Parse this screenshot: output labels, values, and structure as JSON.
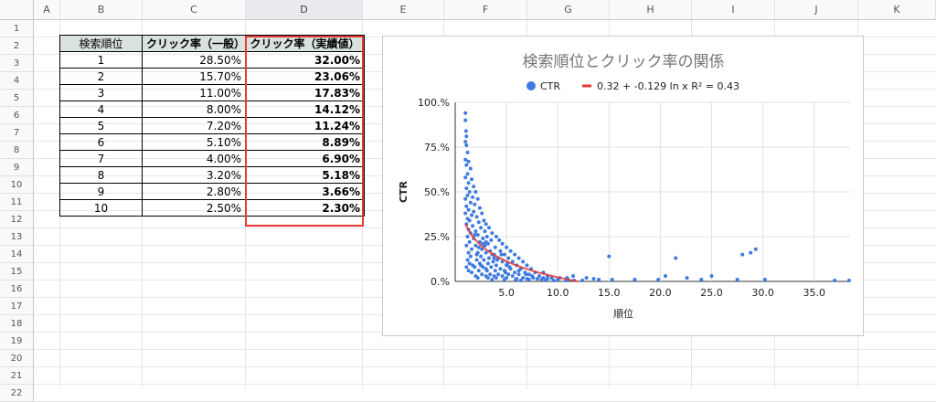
{
  "sheet": {
    "columns": [
      "A",
      "B",
      "C",
      "D",
      "E",
      "F",
      "G",
      "H",
      "I",
      "J",
      "K"
    ],
    "rows": [
      "1",
      "2",
      "3",
      "4",
      "5",
      "6",
      "7",
      "8",
      "9",
      "10",
      "11",
      "12",
      "13",
      "14",
      "15",
      "16",
      "17",
      "18",
      "19",
      "20",
      "21",
      "22"
    ]
  },
  "table": {
    "headers": [
      "検索順位",
      "クリック率（一般）",
      "クリック率（実績値）"
    ],
    "rows": [
      [
        "1",
        "28.50%",
        "32.00%"
      ],
      [
        "2",
        "15.70%",
        "23.06%"
      ],
      [
        "3",
        "11.00%",
        "17.83%"
      ],
      [
        "4",
        "8.00%",
        "14.12%"
      ],
      [
        "5",
        "7.20%",
        "11.24%"
      ],
      [
        "6",
        "5.10%",
        "8.89%"
      ],
      [
        "7",
        "4.00%",
        "6.90%"
      ],
      [
        "8",
        "3.20%",
        "5.18%"
      ],
      [
        "9",
        "2.80%",
        "3.66%"
      ],
      [
        "10",
        "2.50%",
        "2.30%"
      ]
    ]
  },
  "chart_data": {
    "type": "scatter",
    "title": "検索順位とクリック率の関係",
    "xlabel": "順位",
    "ylabel": "CTR",
    "xlim": [
      0,
      38.5
    ],
    "ylim": [
      0,
      1.0
    ],
    "xticks": [
      "5.0",
      "10.0",
      "15.0",
      "20.0",
      "25.0",
      "30.0",
      "35.0"
    ],
    "xtick_values": [
      5,
      10,
      15,
      20,
      25,
      30,
      35
    ],
    "yticks": [
      "0.%",
      "25.%",
      "50.%",
      "75.%",
      "100.%"
    ],
    "ytick_values": [
      0,
      0.25,
      0.5,
      0.75,
      1.0
    ],
    "grid": true,
    "legend_position": "top",
    "series": [
      {
        "name": "CTR",
        "color": "#3f7be0",
        "points": [
          [
            1.0,
            0.94
          ],
          [
            1.0,
            0.9
          ],
          [
            1.05,
            0.84
          ],
          [
            1.1,
            0.81
          ],
          [
            1.0,
            0.78
          ],
          [
            1.1,
            0.76
          ],
          [
            1.2,
            0.72
          ],
          [
            1.0,
            0.68
          ],
          [
            1.3,
            0.67
          ],
          [
            1.1,
            0.65
          ],
          [
            1.5,
            0.63
          ],
          [
            1.2,
            0.6
          ],
          [
            1.0,
            0.58
          ],
          [
            1.6,
            0.57
          ],
          [
            1.3,
            0.55
          ],
          [
            1.8,
            0.53
          ],
          [
            1.1,
            0.52
          ],
          [
            1.4,
            0.5
          ],
          [
            2.0,
            0.5
          ],
          [
            1.2,
            0.48
          ],
          [
            1.7,
            0.47
          ],
          [
            1.0,
            0.46
          ],
          [
            2.2,
            0.46
          ],
          [
            1.5,
            0.44
          ],
          [
            1.9,
            0.43
          ],
          [
            1.1,
            0.42
          ],
          [
            2.4,
            0.41
          ],
          [
            1.3,
            0.4
          ],
          [
            1.8,
            0.39
          ],
          [
            2.6,
            0.38
          ],
          [
            1.0,
            0.38
          ],
          [
            1.6,
            0.37
          ],
          [
            2.1,
            0.36
          ],
          [
            1.2,
            0.35
          ],
          [
            2.8,
            0.34
          ],
          [
            1.4,
            0.34
          ],
          [
            2.3,
            0.33
          ],
          [
            3.0,
            0.32
          ],
          [
            1.1,
            0.32
          ],
          [
            1.7,
            0.31
          ],
          [
            2.5,
            0.3
          ],
          [
            3.3,
            0.3
          ],
          [
            1.3,
            0.29
          ],
          [
            2.0,
            0.28
          ],
          [
            2.9,
            0.28
          ],
          [
            3.6,
            0.27
          ],
          [
            1.5,
            0.27
          ],
          [
            2.2,
            0.26
          ],
          [
            3.1,
            0.25
          ],
          [
            4.0,
            0.25
          ],
          [
            1.2,
            0.25
          ],
          [
            1.8,
            0.24
          ],
          [
            2.7,
            0.24
          ],
          [
            3.5,
            0.23
          ],
          [
            4.3,
            0.23
          ],
          [
            1.4,
            0.22
          ],
          [
            2.4,
            0.22
          ],
          [
            3.2,
            0.21
          ],
          [
            4.6,
            0.21
          ],
          [
            1.1,
            0.2
          ],
          [
            2.0,
            0.2
          ],
          [
            2.9,
            0.2
          ],
          [
            3.9,
            0.19
          ],
          [
            5.0,
            0.19
          ],
          [
            1.6,
            0.18
          ],
          [
            2.6,
            0.18
          ],
          [
            3.4,
            0.17
          ],
          [
            4.4,
            0.17
          ],
          [
            5.4,
            0.17
          ],
          [
            1.3,
            0.16
          ],
          [
            2.2,
            0.16
          ],
          [
            3.0,
            0.16
          ],
          [
            3.8,
            0.15
          ],
          [
            4.8,
            0.15
          ],
          [
            5.8,
            0.15
          ],
          [
            1.5,
            0.14
          ],
          [
            2.5,
            0.14
          ],
          [
            3.3,
            0.13
          ],
          [
            4.2,
            0.13
          ],
          [
            5.2,
            0.13
          ],
          [
            6.2,
            0.13
          ],
          [
            1.2,
            0.12
          ],
          [
            2.1,
            0.12
          ],
          [
            2.8,
            0.12
          ],
          [
            3.7,
            0.11
          ],
          [
            4.6,
            0.11
          ],
          [
            5.6,
            0.11
          ],
          [
            6.6,
            0.11
          ],
          [
            1.4,
            0.1
          ],
          [
            2.4,
            0.1
          ],
          [
            3.2,
            0.1
          ],
          [
            4.0,
            0.09
          ],
          [
            5.0,
            0.09
          ],
          [
            6.0,
            0.09
          ],
          [
            7.0,
            0.09
          ],
          [
            1.1,
            0.08
          ],
          [
            1.9,
            0.08
          ],
          [
            2.7,
            0.08
          ],
          [
            3.5,
            0.08
          ],
          [
            4.4,
            0.07
          ],
          [
            5.4,
            0.07
          ],
          [
            6.4,
            0.07
          ],
          [
            7.4,
            0.07
          ],
          [
            1.3,
            0.06
          ],
          [
            2.3,
            0.06
          ],
          [
            3.1,
            0.06
          ],
          [
            3.9,
            0.06
          ],
          [
            4.8,
            0.06
          ],
          [
            5.8,
            0.05
          ],
          [
            6.8,
            0.05
          ],
          [
            7.8,
            0.05
          ],
          [
            8.6,
            0.05
          ],
          [
            1.6,
            0.05
          ],
          [
            2.6,
            0.04
          ],
          [
            3.4,
            0.04
          ],
          [
            4.2,
            0.04
          ],
          [
            5.2,
            0.04
          ],
          [
            6.2,
            0.04
          ],
          [
            7.2,
            0.04
          ],
          [
            8.2,
            0.03
          ],
          [
            9.0,
            0.03
          ],
          [
            2.0,
            0.03
          ],
          [
            3.0,
            0.03
          ],
          [
            3.8,
            0.03
          ],
          [
            4.6,
            0.03
          ],
          [
            5.6,
            0.03
          ],
          [
            6.6,
            0.02
          ],
          [
            7.6,
            0.02
          ],
          [
            8.6,
            0.02
          ],
          [
            9.4,
            0.02
          ],
          [
            10.2,
            0.02
          ],
          [
            2.2,
            0.02
          ],
          [
            3.2,
            0.02
          ],
          [
            4.0,
            0.02
          ],
          [
            5.0,
            0.02
          ],
          [
            6.0,
            0.015
          ],
          [
            7.0,
            0.015
          ],
          [
            8.0,
            0.015
          ],
          [
            9.0,
            0.015
          ],
          [
            10.0,
            0.01
          ],
          [
            11.0,
            0.01
          ],
          [
            3.6,
            0.01
          ],
          [
            4.8,
            0.01
          ],
          [
            5.9,
            0.01
          ],
          [
            7.2,
            0.01
          ],
          [
            8.4,
            0.01
          ],
          [
            9.6,
            0.005
          ],
          [
            10.8,
            0.005
          ],
          [
            11.6,
            0.005
          ],
          [
            12.4,
            0.005
          ],
          [
            6.4,
            0.005
          ],
          [
            8.8,
            0.005
          ],
          [
            2.3,
            0.19
          ],
          [
            2.7,
            0.21
          ],
          [
            3.6,
            0.15
          ],
          [
            4.1,
            0.12
          ],
          [
            1.9,
            0.26
          ],
          [
            2.1,
            0.15
          ],
          [
            2.5,
            0.09
          ],
          [
            3.0,
            0.07
          ],
          [
            1.7,
            0.09
          ],
          [
            3.0,
            0.22
          ],
          [
            3.8,
            0.13
          ],
          [
            5.1,
            0.1
          ],
          [
            6.2,
            0.06
          ],
          [
            4.5,
            0.15
          ],
          [
            5.3,
            0.08
          ],
          [
            6.9,
            0.04
          ],
          [
            7.5,
            0.03
          ],
          [
            4.9,
            0.05
          ],
          [
            11.5,
            0.03
          ],
          [
            10.9,
            0.02
          ],
          [
            12.8,
            0.02
          ],
          [
            13.5,
            0.015
          ],
          [
            14.0,
            0.01
          ],
          [
            15.0,
            0.14
          ],
          [
            15.3,
            0.01
          ],
          [
            17.5,
            0.01
          ],
          [
            19.8,
            0.01
          ],
          [
            20.5,
            0.03
          ],
          [
            21.5,
            0.13
          ],
          [
            22.6,
            0.02
          ],
          [
            24.0,
            0.01
          ],
          [
            25.0,
            0.03
          ],
          [
            27.5,
            0.01
          ],
          [
            28.0,
            0.15
          ],
          [
            28.8,
            0.16
          ],
          [
            29.3,
            0.18
          ],
          [
            30.2,
            0.01
          ],
          [
            37.0,
            0.005
          ],
          [
            38.4,
            0.005
          ]
        ]
      }
    ],
    "trendline": {
      "name": "0.32 + -0.129 ln x R² = 0.43",
      "color": "#e53935",
      "a": 0.32,
      "b": -0.129,
      "xrange": [
        1,
        12
      ]
    }
  }
}
